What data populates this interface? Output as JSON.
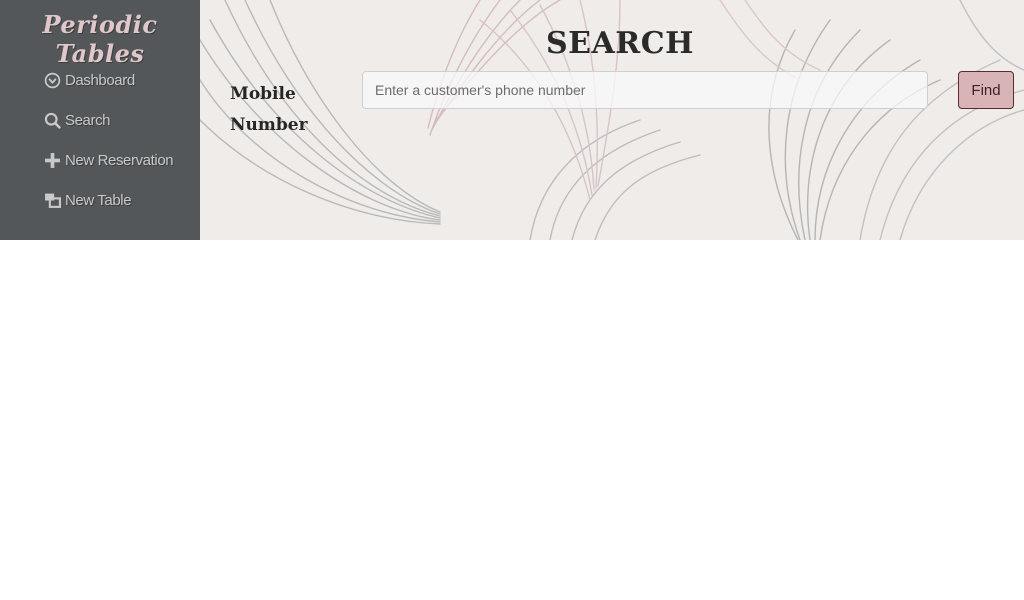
{
  "app": {
    "brand": "Periodic Tables"
  },
  "sidebar": {
    "items": [
      {
        "label": "Dashboard",
        "icon": "dashboard-icon"
      },
      {
        "label": "Search",
        "icon": "search-icon"
      },
      {
        "label": "New Reservation",
        "icon": "plus-icon"
      },
      {
        "label": "New Table",
        "icon": "table-icon"
      }
    ]
  },
  "main": {
    "title": "SEARCH",
    "mobile_label": "Mobile Number",
    "phone_input": {
      "value": "",
      "placeholder": "Enter a customer's phone number"
    },
    "find_label": "Find"
  },
  "colors": {
    "sidebar_bg": "#545759",
    "brand_text": "#e0c8ca",
    "nav_text": "#c9c9c9",
    "find_button": "#d9b4b7",
    "find_border": "#5a2a2e",
    "page_bg": "#efecea"
  }
}
